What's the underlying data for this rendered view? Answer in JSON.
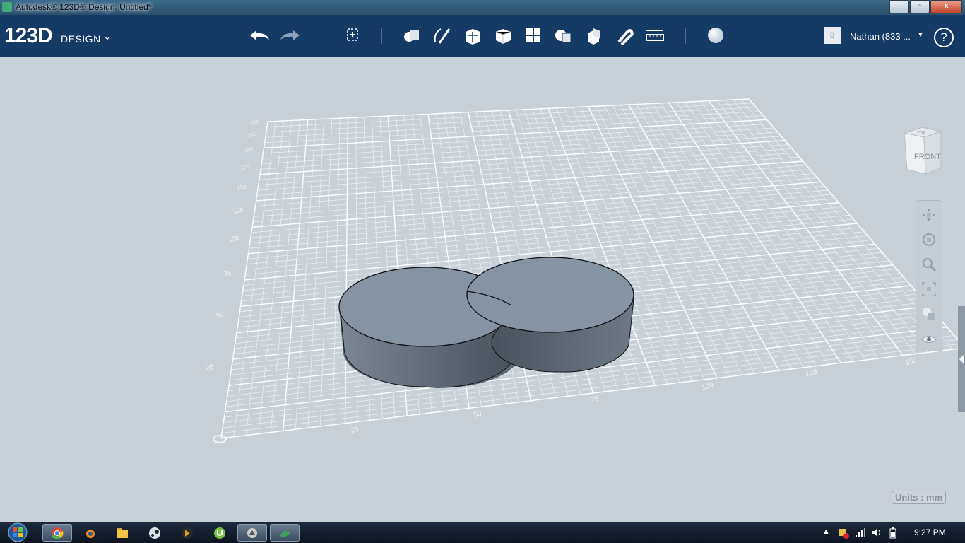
{
  "window": {
    "title": "Autodesk® 123D® Design: Untitled*",
    "minimize": "–",
    "maximize": "▫",
    "close": "x"
  },
  "app": {
    "logo": "123D",
    "logo_sub": "DESIGN"
  },
  "toolbar": {
    "undo": "undo-icon",
    "redo": "redo-icon",
    "tools": [
      "transform",
      "primitives",
      "sketch",
      "construct",
      "modify",
      "pattern",
      "grouping",
      "combine",
      "measure-snap",
      "snap",
      "measure",
      "material"
    ]
  },
  "user": {
    "avatar": "8",
    "name": "Nathan (833 ..."
  },
  "help": "?",
  "viewcube": {
    "top": "TOP",
    "front": "FRONT"
  },
  "grid": {
    "x_ticks": [
      "25",
      "50",
      "75",
      "100",
      "125",
      "150"
    ],
    "y_ticks": [
      "25",
      "50",
      "75",
      "100",
      "125",
      "150",
      "175",
      "200",
      "225",
      "250"
    ]
  },
  "units": "Units : mm",
  "taskbar": {
    "apps": [
      "chrome",
      "blender",
      "explorer",
      "steam",
      "plex",
      "utorrent",
      "unknown",
      "123d"
    ]
  },
  "clock": "9:27 PM"
}
